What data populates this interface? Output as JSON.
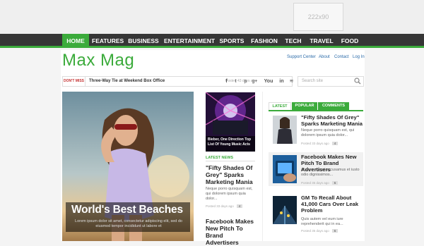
{
  "ad": {
    "label": "222x90"
  },
  "nav": {
    "items": [
      "HOME",
      "FEATURES",
      "BUSINESS",
      "ENTERTAINMENT",
      "SPORTS",
      "FASHION",
      "TECH",
      "TRAVEL",
      "FOOD"
    ]
  },
  "site": {
    "logo": "Max Mag",
    "accent": "#3bab3b"
  },
  "toplinks": [
    "Support Center",
    "About",
    "Contact",
    "Log In"
  ],
  "ticker": {
    "label": "DON'T MISS",
    "headline": "Three-Way Tie at Weekend Box Office",
    "posted": "Posted 43 days ago"
  },
  "social": [
    "facebook-icon",
    "twitter-icon",
    "pinterest-icon",
    "googleplus-icon",
    "youtube-icon",
    "linkedin-icon",
    "rss-icon"
  ],
  "social_glyphs": [
    "f",
    "t",
    "p",
    "g+",
    "You",
    "in",
    "≋"
  ],
  "search": {
    "placeholder": "Search site"
  },
  "hero": {
    "title": "World's Best Beaches",
    "excerpt": "Lorem ipsum dolor sit amet, consectetur adipiscing elit, sed do eiusmod tempor incididunt ut labore et"
  },
  "spotlight": {
    "title": "Bieber, One Direction Top List Of Young Music Acts"
  },
  "latest": {
    "heading": "LATEST NEWS",
    "title": "\"Fifty Shades Of Grey\" Sparks Marketing Mania",
    "excerpt": "Neque porro quisquam est, qui dolorem ipsum quia dolor...",
    "posted": "Posted 33 days ago",
    "count": "4",
    "next_title": "Facebook Makes New Pitch To Brand Advertisers"
  },
  "tabs": [
    {
      "label": "LATEST"
    },
    {
      "label": "POPULAR"
    },
    {
      "label": "COMMENTS"
    }
  ],
  "sidebar": {
    "items": [
      {
        "title": "\"Fifty Shades Of Grey\" Sparks Marketing Mania",
        "excerpt": "Neque porro quisquam est, qui dolorem ipsum quia dolor...",
        "posted": "Posted 33 days ago",
        "count": "4"
      },
      {
        "title": "Facebook Makes New Pitch To Brand Advertisers",
        "excerpt": "At vero eos et accusamus et iusto odio dignissimos...",
        "posted": "Posted 35 days ago",
        "count": "6"
      },
      {
        "title": "GM To Recall About 41,000 Cars Over Leak Problem",
        "excerpt": "Quis autem vel eum iure reprehenderit qui in ea...",
        "posted": "Posted 35 days ago",
        "count": "6"
      }
    ]
  }
}
